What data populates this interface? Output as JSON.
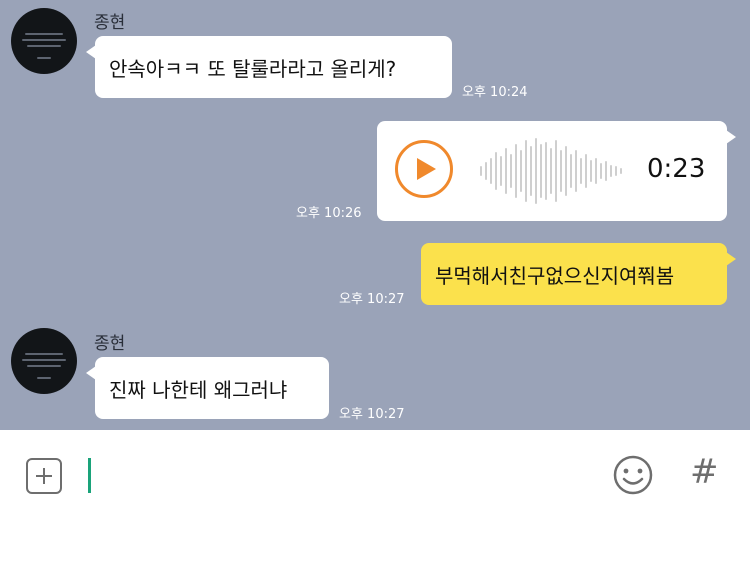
{
  "messages": [
    {
      "sender": "종현",
      "text": "안속아ㅋㅋ 또 탈룰라라고 올리게?",
      "time": "오후 10:24",
      "direction": "incoming"
    },
    {
      "type": "voice",
      "duration": "0:23",
      "time": "오후 10:26",
      "direction": "outgoing"
    },
    {
      "text": "부먹해서친구없으신지여쭤봄",
      "time": "오후 10:27",
      "direction": "outgoing"
    },
    {
      "sender": "종현",
      "text": "진짜 나한테 왜그러냐",
      "time": "오후 10:27",
      "direction": "incoming"
    }
  ],
  "input": {
    "value": ""
  },
  "icons": {
    "attach": "plus-square-icon",
    "emoji": "smiley-icon",
    "hashtag": "hash-icon"
  },
  "hash_glyph": "#",
  "colors": {
    "chat_bg": "#9aa3b8",
    "outgoing_bubble": "#fbe14c",
    "incoming_bubble": "#ffffff",
    "play_accent": "#f0892c",
    "cursor": "#1aa37a"
  }
}
